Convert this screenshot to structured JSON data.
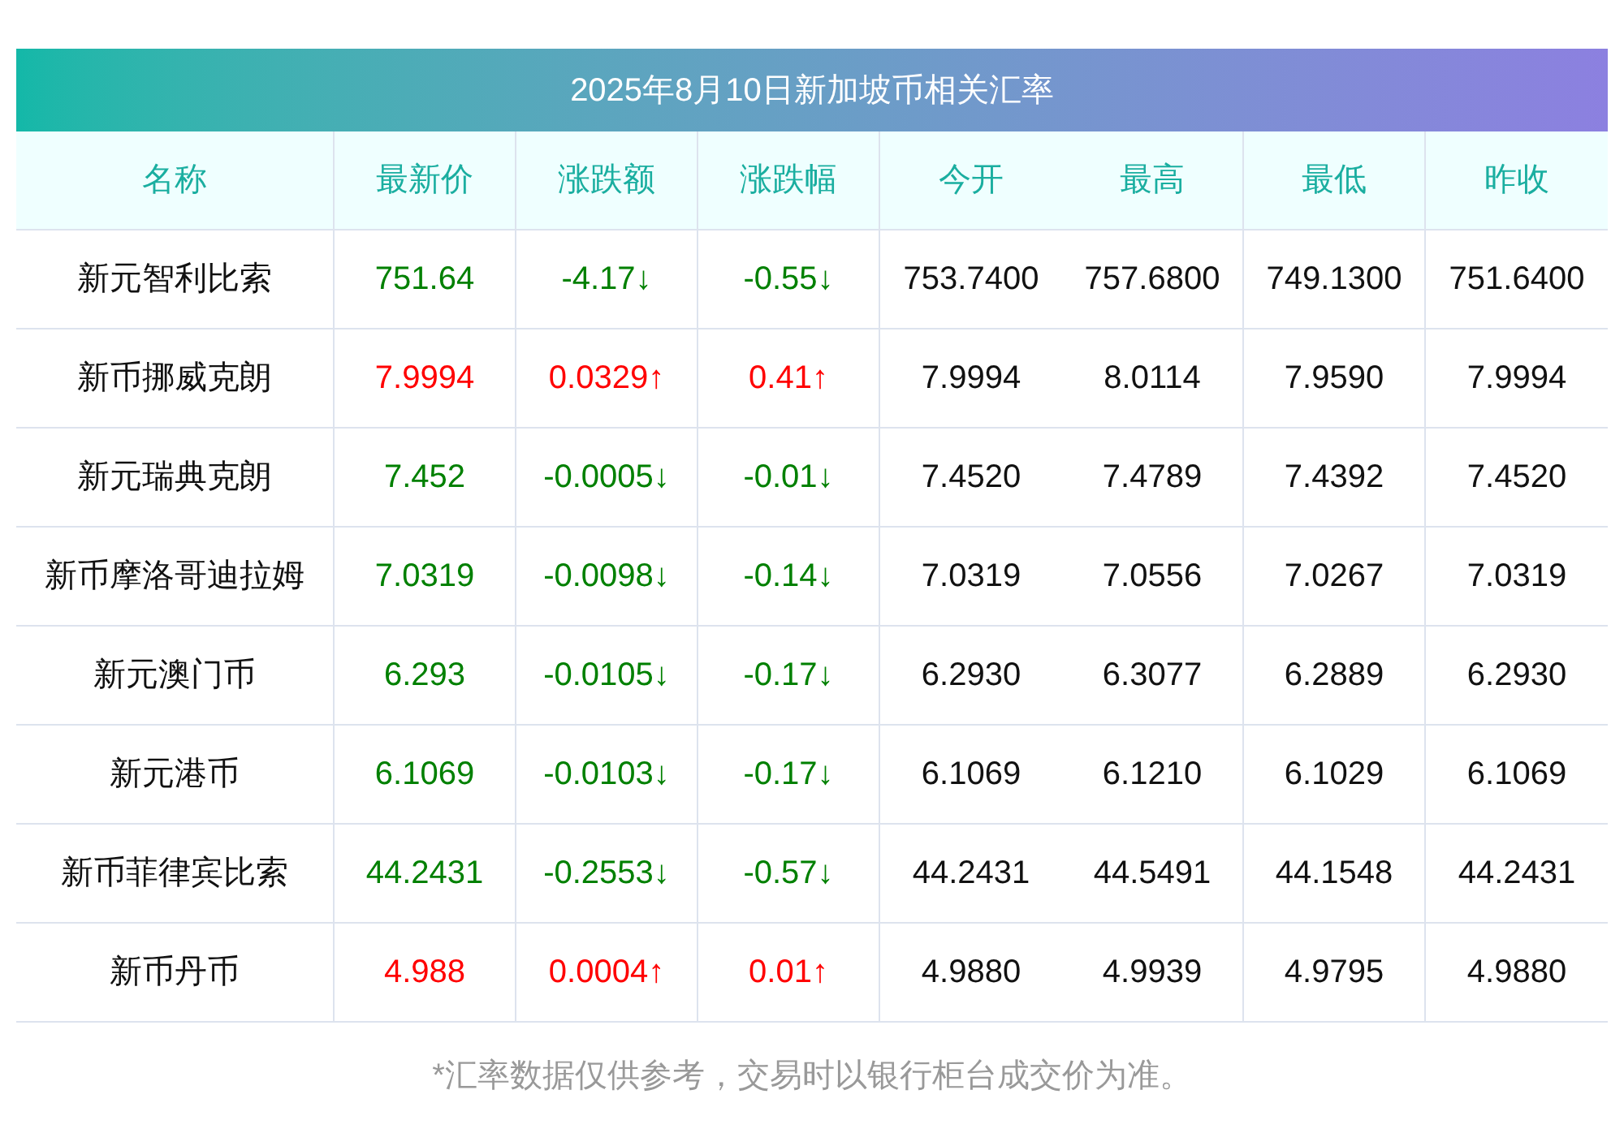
{
  "title": "2025年8月10日新加坡币相关汇率",
  "columns": [
    "名称",
    "最新价",
    "涨跌额",
    "涨跌幅",
    "今开",
    "最高",
    "最低",
    "昨收"
  ],
  "rows": [
    {
      "color": "#008000",
      "cells": [
        "新元智利比索",
        "751.64",
        "-4.17↓",
        "-0.55↓",
        "753.7400",
        "757.6800",
        "749.1300",
        "751.6400"
      ]
    },
    {
      "color": "#ff0000",
      "cells": [
        "新币挪威克朗",
        "7.9994",
        "0.0329↑",
        "0.41↑",
        "7.9994",
        "8.0114",
        "7.9590",
        "7.9994"
      ]
    },
    {
      "color": "#008000",
      "cells": [
        "新元瑞典克朗",
        "7.452",
        "-0.0005↓",
        "-0.01↓",
        "7.4520",
        "7.4789",
        "7.4392",
        "7.4520"
      ]
    },
    {
      "color": "#008000",
      "cells": [
        "新币摩洛哥迪拉姆",
        "7.0319",
        "-0.0098↓",
        "-0.14↓",
        "7.0319",
        "7.0556",
        "7.0267",
        "7.0319"
      ]
    },
    {
      "color": "#008000",
      "cells": [
        "新元澳门币",
        "6.293",
        "-0.0105↓",
        "-0.17↓",
        "6.2930",
        "6.3077",
        "6.2889",
        "6.2930"
      ]
    },
    {
      "color": "#008000",
      "cells": [
        "新元港币",
        "6.1069",
        "-0.0103↓",
        "-0.17↓",
        "6.1069",
        "6.1210",
        "6.1029",
        "6.1069"
      ]
    },
    {
      "color": "#008000",
      "cells": [
        "新币菲律宾比索",
        "44.2431",
        "-0.2553↓",
        "-0.57↓",
        "44.2431",
        "44.5491",
        "44.1548",
        "44.2431"
      ]
    },
    {
      "color": "#ff0000",
      "cells": [
        "新币丹币",
        "4.988",
        "0.0004↑",
        "0.01↑",
        "4.9880",
        "4.9939",
        "4.9795",
        "4.9880"
      ]
    }
  ],
  "footnote": "*汇率数据仅供参考，交易时以银行柜台成交价为准。"
}
